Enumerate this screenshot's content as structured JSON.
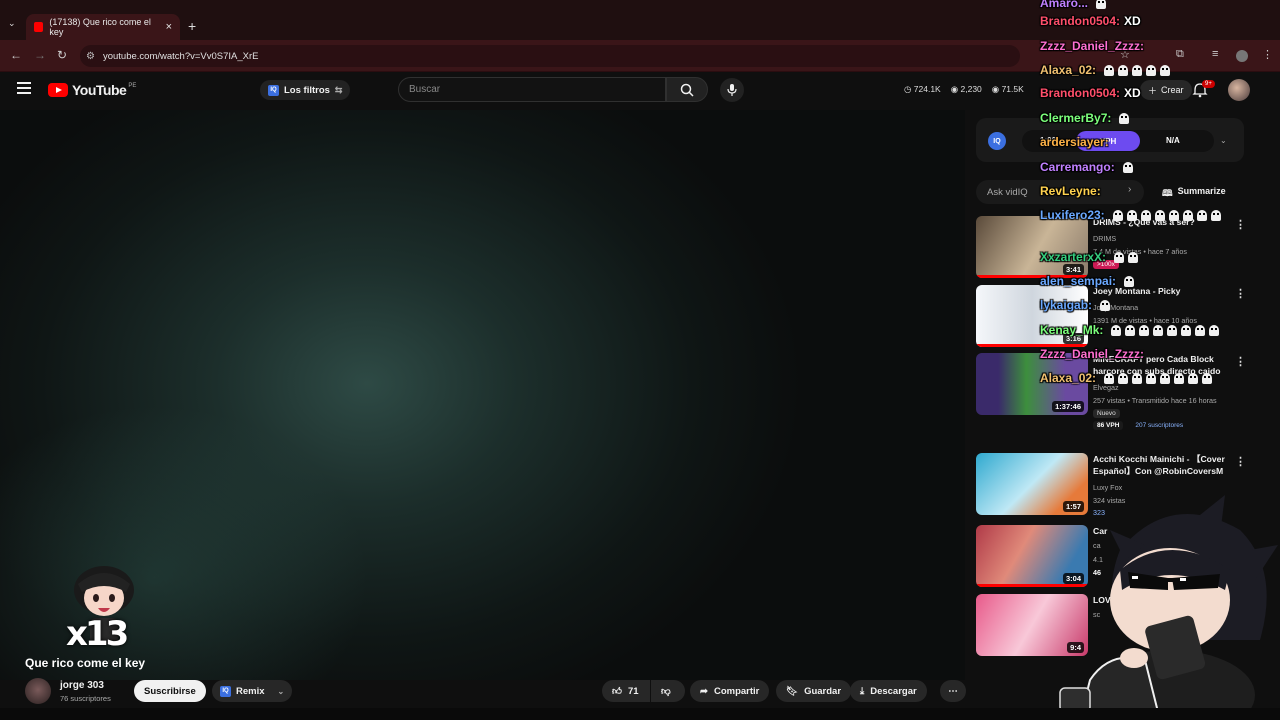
{
  "browser": {
    "tab_title": "(17138) Que rico come el key",
    "tab_close": "×",
    "new_tab": "+",
    "url": "youtube.com/watch?v=Vv0S7IA_XrE"
  },
  "masthead": {
    "logo_text": "YouTube",
    "logo_country": "PE",
    "filters_label": "Los filtros",
    "search_placeholder": "Buscar",
    "stats": [
      "724.1K",
      "2,230",
      "71.5K"
    ],
    "create_label": "Crear",
    "notif_badge": "9+"
  },
  "video": {
    "title": "Que rico come el key",
    "overlay_text": "x13",
    "channel_name": "jorge 303",
    "channel_subs": "76 suscriptores",
    "subscribe_label": "Suscribirse",
    "remix_label": "Remix",
    "likes": "71",
    "share_label": "Compartir",
    "save_label": "Guardar",
    "download_label": "Descargar"
  },
  "vidiq": {
    "logo": "IQ",
    "time_value": "1:00",
    "vph_label": "VPH",
    "na_label": "N/A",
    "ask_placeholder": "Ask vidIQ",
    "summarize_label": "Summarize"
  },
  "recommended": [
    {
      "title": "DRIMS - ¿Qué vas a ser?",
      "channel": "DRIMS",
      "meta": "7,4 M de vistas • hace 7 años",
      "duration": "3:41",
      "badge": ">100x",
      "colors": [
        "#6b5a4a",
        "#b9a48a"
      ]
    },
    {
      "title": "Joey Montana - Picky",
      "channel": "Joey Montana",
      "meta": "1391 M de vistas • hace 10 años",
      "duration": "3:16",
      "colors": [
        "#d8dde3",
        "#ffffff"
      ]
    },
    {
      "title": "MINECRAFT pero Cada Block harcore con subs directo caido",
      "channel": "Elvegaz",
      "meta": "257 vistas • Transmitido hace 16 horas",
      "duration": "1:37:46",
      "tag": "Nuevo",
      "vph": "86 VPH",
      "subs": "207 suscriptores",
      "colors": [
        "#4a3a7a",
        "#3a8a3a"
      ]
    },
    {
      "title": "Acchi Kocchi Mainichi - 【Cover Español】Con @RobinCoversM",
      "channel": "Luxy Fox",
      "meta": "324 vistas",
      "duration": "1:57",
      "subs": "323",
      "colors": [
        "#3fb7d8",
        "#eaf6fb"
      ]
    },
    {
      "title": "Car",
      "channel": "ca",
      "meta": "4.1",
      "duration": "3:04",
      "vph": "46",
      "colors": [
        "#b03a48",
        "#3a7ab0"
      ]
    },
    {
      "title": "LOV",
      "channel": "sc",
      "meta": "",
      "duration": "9:4",
      "colors": [
        "#e85a8a",
        "#f8c8d8"
      ]
    }
  ],
  "chat": [
    {
      "user": "Amaro...",
      "color": "#c080ff",
      "msg": ""
    },
    {
      "user": "Brandon0504:",
      "color": "#ff4f6b",
      "msg": "XD"
    },
    {
      "user": "Zzzz_Daniel_Zzzz:",
      "color": "#ff6fd0",
      "msg": ""
    },
    {
      "user": "Alaxa_02:",
      "color": "#f0c070",
      "msg": ""
    },
    {
      "user": "Brandon0504:",
      "color": "#ff4f6b",
      "msg": "XD"
    },
    {
      "user": "ClermerBy7:",
      "color": "#7cff7c",
      "msg": ""
    },
    {
      "user": "ardersiayer:",
      "color": "#ffb347",
      "msg": ""
    },
    {
      "user": "Carremango:",
      "color": "#c080ff",
      "msg": ""
    },
    {
      "user": "RevLeyne:",
      "color": "#ffd24f",
      "msg": ""
    },
    {
      "user": "Luxifero23:",
      "color": "#6aa8ff",
      "msg": ""
    },
    {
      "user": "XxzarterxX:",
      "color": "#35d07f",
      "msg": ""
    },
    {
      "user": "alen_sempai:",
      "color": "#6aa8ff",
      "msg": ""
    },
    {
      "user": "lykaigab:",
      "color": "#6aa8ff",
      "msg": ""
    },
    {
      "user": "Kenay_Mk:",
      "color": "#7cff7c",
      "msg": ""
    },
    {
      "user": "Zzzz_Daniel_Zzzz:",
      "color": "#ff6fd0",
      "msg": ""
    },
    {
      "user": "Alaxa_02:",
      "color": "#f0c070",
      "msg": ""
    }
  ]
}
